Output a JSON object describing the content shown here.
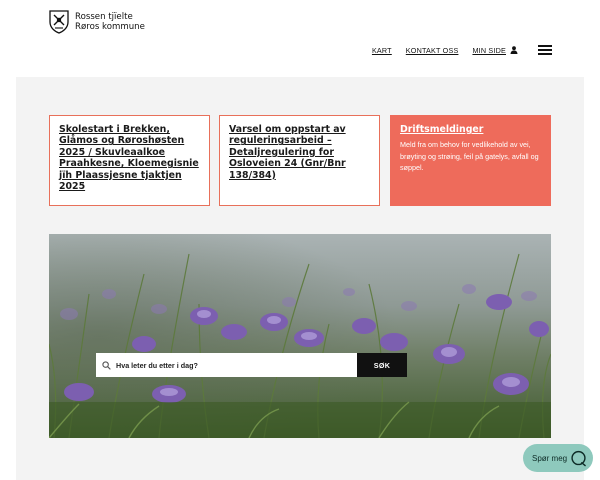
{
  "header": {
    "logo_line1": "Rossen tjïelte",
    "logo_line2": "Røros kommune",
    "logo_icon": "crest-icon"
  },
  "nav": {
    "kart": "KART",
    "kontakt": "KONTAKT OSS",
    "minside": "MIN SIDE",
    "user_icon": "user-icon",
    "menu_icon": "hamburger-menu-icon"
  },
  "cards": [
    {
      "title": "Skolestart i Brekken, Glåmos og Røroshøsten 2025 / Skuvleaalkoe Praahkesne, Kloemegisnie jïh Plaassjesne tjaktjen 2025"
    },
    {
      "title": "Varsel om oppstart av reguleringsarbeid – Detaljregulering for Osloveien 24 (Gnr/Bnr 138/384)"
    },
    {
      "title": "Driftsmeldinger",
      "description": "Meld fra om behov for vedlikehold av vei, brøyting og strøing, feil på gatelys, avfall og søppel."
    }
  ],
  "search": {
    "placeholder": "Hva leter du etter i dag?",
    "button": "SØK"
  },
  "chat": {
    "label": "Spør meg"
  },
  "colors": {
    "accent": "#ee6b5b",
    "card_border": "#e8705a",
    "panel": "#f3f3f3",
    "chat": "#8ec9bd"
  }
}
